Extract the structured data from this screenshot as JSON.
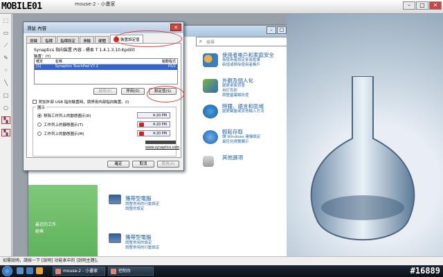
{
  "app": {
    "logo_text": "MOBILE01",
    "title": "mouse-2 - 小畫家"
  },
  "explorer": {
    "search_placeholder": "搜尋",
    "items": [
      {
        "title": "使用者帳戶和家庭安全",
        "links": [
          "為使用者設定家長監護",
          "新增或移除使用者帳戶"
        ]
      },
      {
        "title": "外觀及個人化",
        "links": [
          "變更桌面背景",
          "自訂色彩",
          "調整螢幕解析度"
        ]
      },
      {
        "title": "時鐘、語言和區域",
        "links": [
          "變更鍵盤或其他輸入方法"
        ]
      },
      {
        "title": "輕鬆存取",
        "links": [
          "讓 Windows 建議設定",
          "最佳化視覺顯示"
        ]
      },
      {
        "title": "其他選項",
        "links": []
      }
    ],
    "sidebar_links": [
      "最近的工作",
      "經典"
    ],
    "laptops": [
      {
        "title": "攜帶型電腦",
        "links": [
          "調整常用的行動設定",
          "調整的設定"
        ]
      },
      {
        "title": "攜帶型電腦",
        "links": [
          "調整常用的設定",
          "調整常用的行動設定"
        ]
      }
    ]
  },
  "dialog": {
    "title": "滑鼠 內容",
    "close": "✕",
    "tabs": [
      "按鍵",
      "指標",
      "指標設定",
      "滑輪",
      "硬體",
      "裝置設定值"
    ],
    "device_header": "Synaptics 指向裝置 內容 - 標本 T 1.4.1.3.10.Kpdilit",
    "device_label": "裝置：(Y)",
    "table_headers": [
      "名稱",
      "驅動程式",
      "確定"
    ],
    "table_row": {
      "col1": "[S]",
      "col2": "Synaptics TouchPad V7.2",
      "col3": "PS/2"
    },
    "buttons": {
      "enable": "啟用(E)",
      "disable": "停用(D)",
      "settings": "設定值(S)"
    },
    "checkbox_label": "附加外部 USB 指向裝置時，請停用內部指向裝置。(I)",
    "tray_group": "圖示",
    "tray_options": [
      {
        "label": "移除工作列上的動態圖示(R)",
        "time": "4:20 PM"
      },
      {
        "label": "工作列上的靜態圖示(T)",
        "time": "4:20 PM"
      },
      {
        "label": "工作列上的動態圖示(M)",
        "time": "4:20 PM"
      }
    ],
    "link": "www.synaptics.com",
    "footer": {
      "ok": "確定",
      "cancel": "取消",
      "apply": "套用(A)"
    }
  },
  "statusbar": {
    "text": "如需說明，請按一下 [說明] 功能表中的 [說明主題]。"
  },
  "taskbar": {
    "tasks": [
      "mouse-2 - 小畫家",
      "控制台"
    ],
    "watermark": "#16889"
  }
}
